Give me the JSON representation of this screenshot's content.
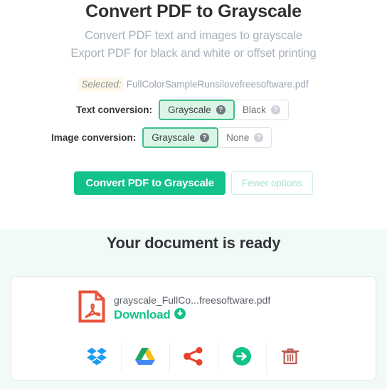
{
  "header": {
    "title": "Convert PDF to Grayscale",
    "subtitle_line1": "Convert PDF text and images to grayscale",
    "subtitle_line2": "Export PDF for black and white or offset printing"
  },
  "selected": {
    "label": "Selected:",
    "filename": "FullColorSampleRunsilovefreesoftware.pdf"
  },
  "options": {
    "text_conversion": {
      "label": "Text conversion:",
      "choices": [
        {
          "label": "Grayscale",
          "selected": true,
          "help": "?"
        },
        {
          "label": "Black",
          "selected": false,
          "help": "?"
        }
      ]
    },
    "image_conversion": {
      "label": "Image conversion:",
      "choices": [
        {
          "label": "Grayscale",
          "selected": true,
          "help": "?"
        },
        {
          "label": "None",
          "selected": false,
          "help": "?"
        }
      ]
    }
  },
  "actions": {
    "primary_label": "Convert PDF to Grayscale",
    "secondary_label": "Fewer options"
  },
  "result": {
    "heading": "Your document is ready",
    "file_icon": "pdf-file-icon",
    "file_name": "grayscale_FullCo...freesoftware.pdf",
    "download_label": "Download",
    "download_icon": "download-circle-icon",
    "share_targets": [
      {
        "name": "dropbox-icon"
      },
      {
        "name": "google-drive-icon"
      },
      {
        "name": "share-icon"
      },
      {
        "name": "continue-arrow-icon"
      },
      {
        "name": "delete-icon"
      }
    ]
  },
  "colors": {
    "accent_green": "#13c28a",
    "selected_option_bg": "#d9f5e6",
    "selected_option_border": "#3fbf8a",
    "mint_section_bg": "#f2faf8",
    "pdf_red": "#e8533a",
    "trash_red": "#b95a52",
    "dropbox_blue": "#1e9cf0",
    "muted_text": "#a7b1bb"
  }
}
